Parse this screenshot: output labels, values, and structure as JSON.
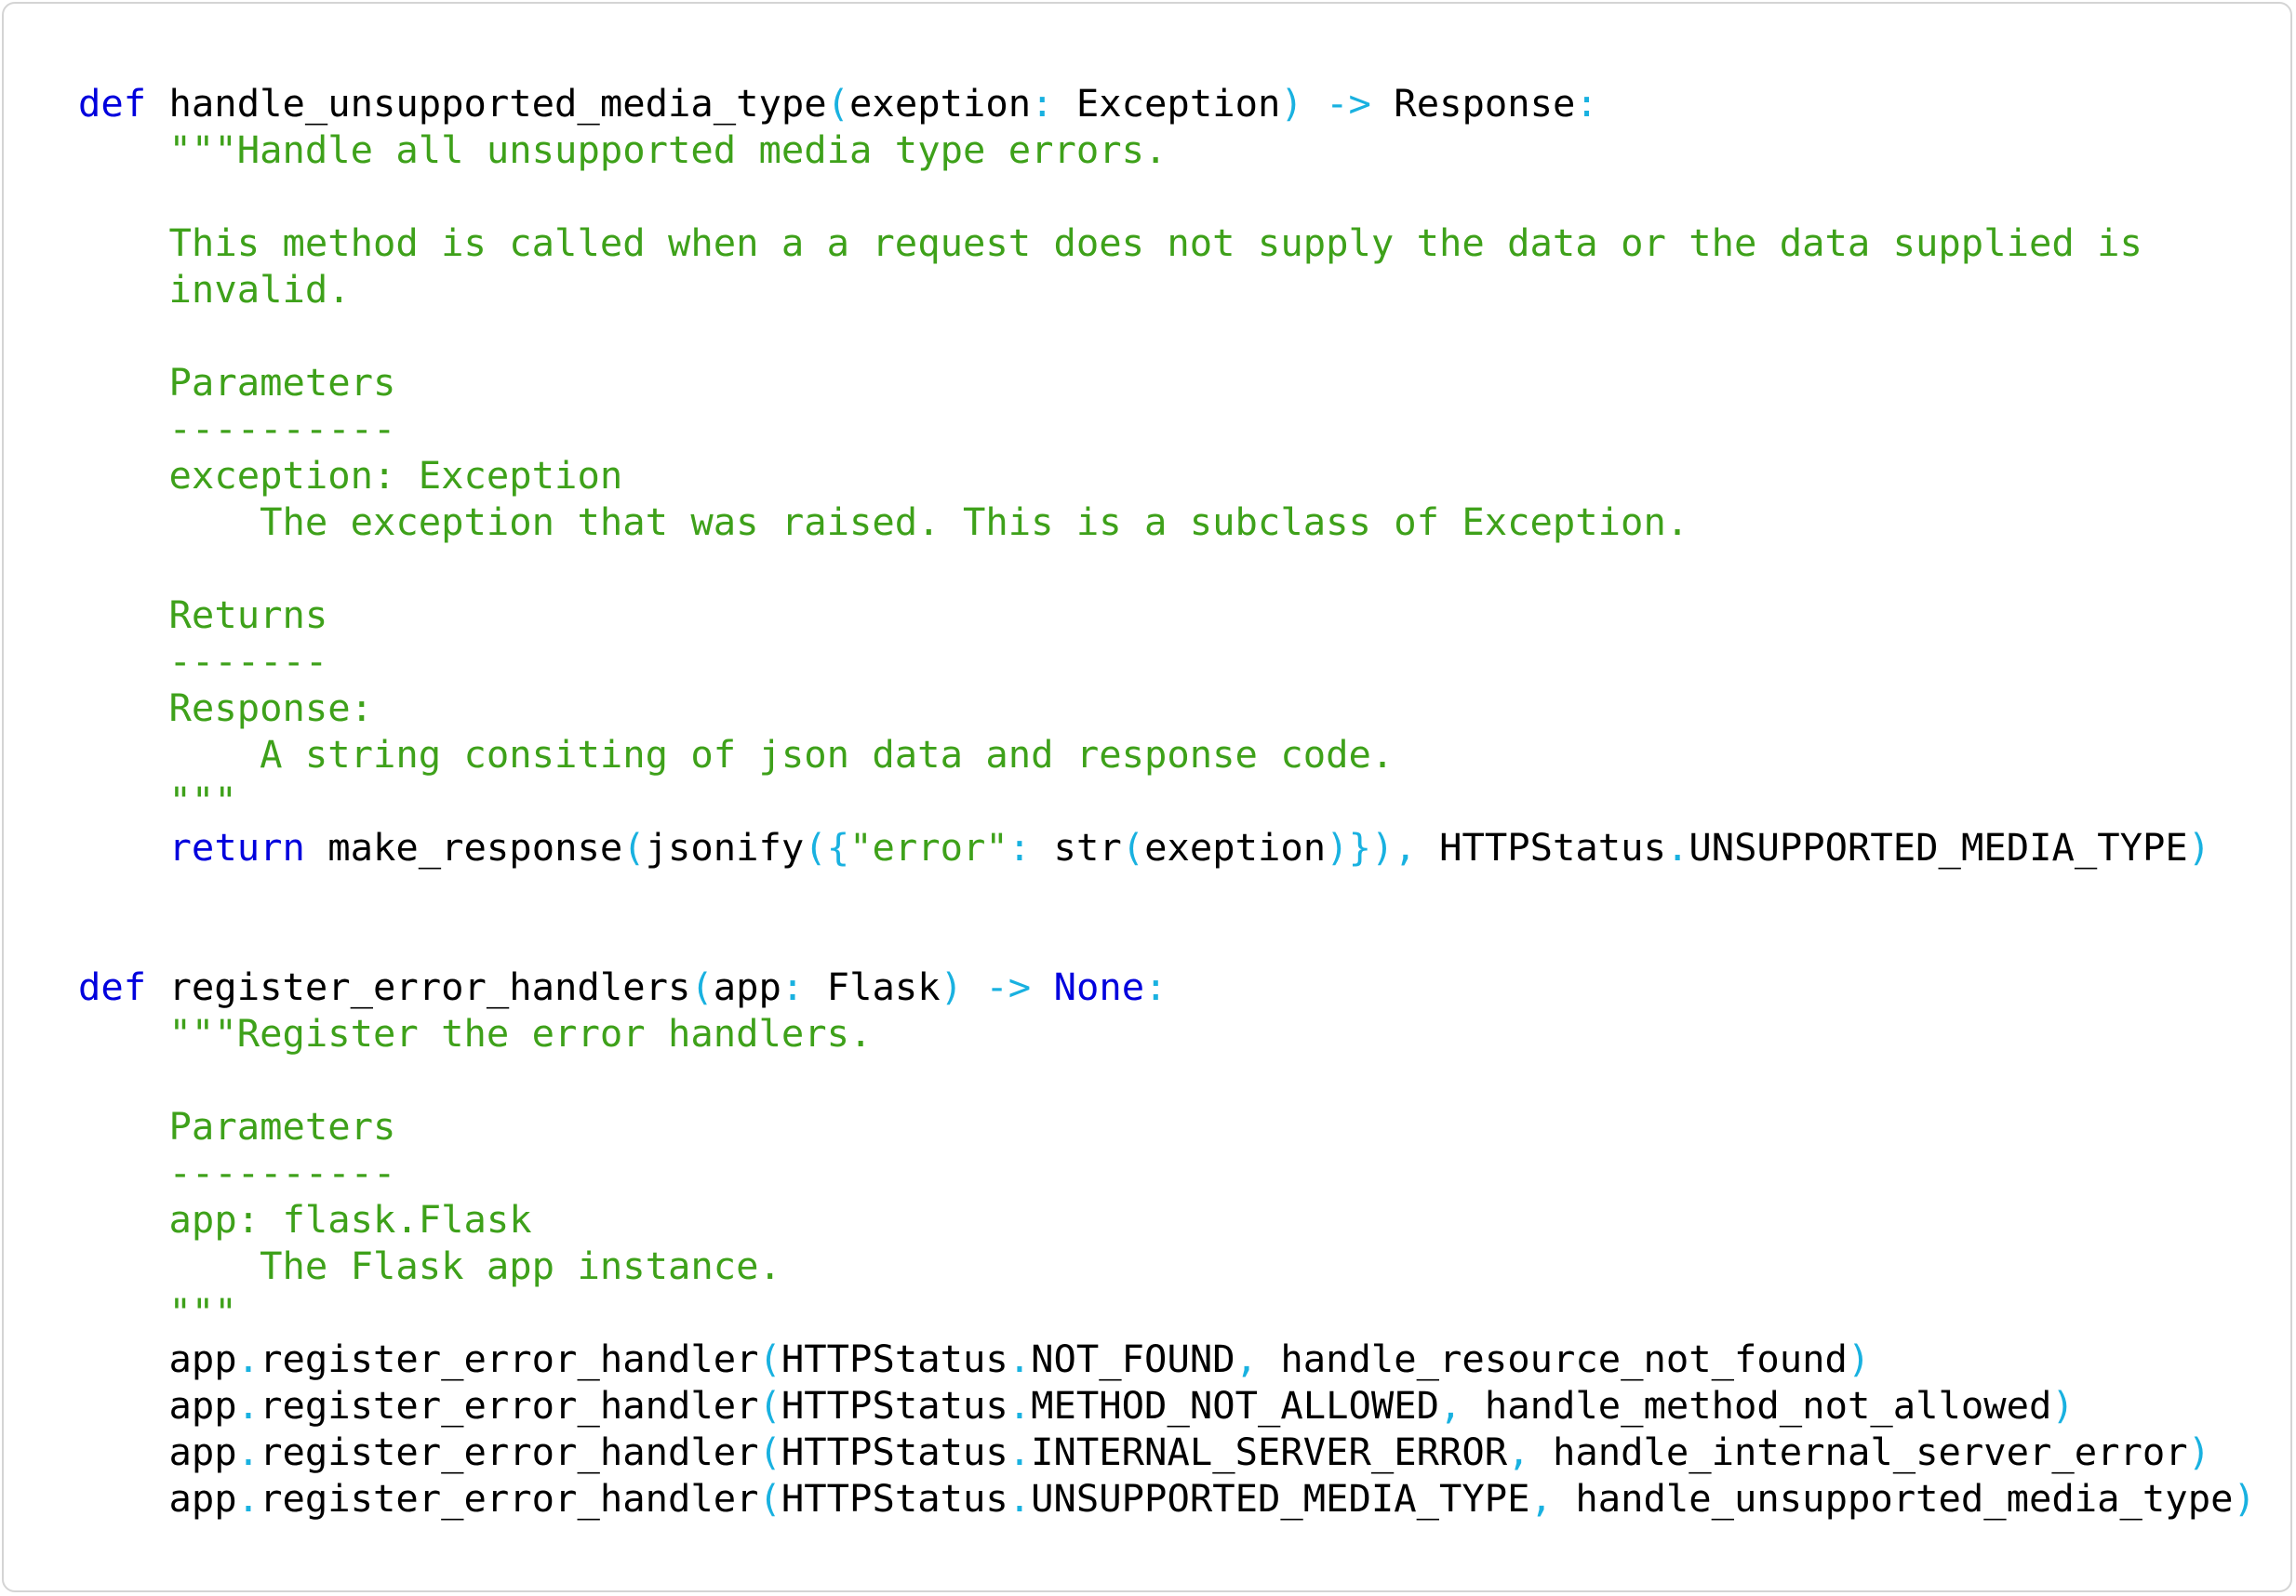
{
  "colors": {
    "keyword": "#0000dd",
    "operator": "#19b1e0",
    "string": "#3ea11a",
    "text": "#000000",
    "border": "#d4d4d4"
  },
  "lines": [
    [
      [
        "kw",
        "def"
      ],
      [
        "id",
        " handle_unsupported_media_type"
      ],
      [
        "op",
        "("
      ],
      [
        "id",
        "exeption"
      ],
      [
        "op",
        ":"
      ],
      [
        "id",
        " Exception"
      ],
      [
        "op",
        ")"
      ],
      [
        "id",
        " "
      ],
      [
        "op",
        "->"
      ],
      [
        "id",
        " Response"
      ],
      [
        "op",
        ":"
      ]
    ],
    [
      [
        "id",
        "    "
      ],
      [
        "str",
        "\"\"\"Handle all unsupported media type errors."
      ]
    ],
    [],
    [
      [
        "id",
        "    "
      ],
      [
        "str",
        "This method is called when a a request does not supply the data or the data supplied is"
      ]
    ],
    [
      [
        "id",
        "    "
      ],
      [
        "str",
        "invalid."
      ]
    ],
    [],
    [
      [
        "id",
        "    "
      ],
      [
        "str",
        "Parameters"
      ]
    ],
    [
      [
        "id",
        "    "
      ],
      [
        "str",
        "----------"
      ]
    ],
    [
      [
        "id",
        "    "
      ],
      [
        "str",
        "exception: Exception"
      ]
    ],
    [
      [
        "id",
        "        "
      ],
      [
        "str",
        "The exception that was raised. This is a subclass of Exception."
      ]
    ],
    [],
    [
      [
        "id",
        "    "
      ],
      [
        "str",
        "Returns"
      ]
    ],
    [
      [
        "id",
        "    "
      ],
      [
        "str",
        "-------"
      ]
    ],
    [
      [
        "id",
        "    "
      ],
      [
        "str",
        "Response:"
      ]
    ],
    [
      [
        "id",
        "        "
      ],
      [
        "str",
        "A string consiting of json data and response code."
      ]
    ],
    [
      [
        "id",
        "    "
      ],
      [
        "str",
        "\"\"\""
      ]
    ],
    [
      [
        "id",
        "    "
      ],
      [
        "kw",
        "return"
      ],
      [
        "id",
        " make_response"
      ],
      [
        "op",
        "("
      ],
      [
        "id",
        "jsonify"
      ],
      [
        "op",
        "({"
      ],
      [
        "str",
        "\"error\""
      ],
      [
        "op",
        ":"
      ],
      [
        "id",
        " str"
      ],
      [
        "op",
        "("
      ],
      [
        "id",
        "exeption"
      ],
      [
        "op",
        ")}),"
      ],
      [
        "id",
        " HTTPStatus"
      ],
      [
        "op",
        "."
      ],
      [
        "id",
        "UNSUPPORTED_MEDIA_TYPE"
      ],
      [
        "op",
        ")"
      ]
    ],
    [],
    [],
    [
      [
        "kw",
        "def"
      ],
      [
        "id",
        " register_error_handlers"
      ],
      [
        "op",
        "("
      ],
      [
        "id",
        "app"
      ],
      [
        "op",
        ":"
      ],
      [
        "id",
        " Flask"
      ],
      [
        "op",
        ")"
      ],
      [
        "id",
        " "
      ],
      [
        "op",
        "->"
      ],
      [
        "id",
        " "
      ],
      [
        "kw",
        "None"
      ],
      [
        "op",
        ":"
      ]
    ],
    [
      [
        "id",
        "    "
      ],
      [
        "str",
        "\"\"\"Register the error handlers."
      ]
    ],
    [],
    [
      [
        "id",
        "    "
      ],
      [
        "str",
        "Parameters"
      ]
    ],
    [
      [
        "id",
        "    "
      ],
      [
        "str",
        "----------"
      ]
    ],
    [
      [
        "id",
        "    "
      ],
      [
        "str",
        "app: flask.Flask"
      ]
    ],
    [
      [
        "id",
        "        "
      ],
      [
        "str",
        "The Flask app instance."
      ]
    ],
    [
      [
        "id",
        "    "
      ],
      [
        "str",
        "\"\"\""
      ]
    ],
    [
      [
        "id",
        "    app"
      ],
      [
        "op",
        "."
      ],
      [
        "id",
        "register_error_handler"
      ],
      [
        "op",
        "("
      ],
      [
        "id",
        "HTTPStatus"
      ],
      [
        "op",
        "."
      ],
      [
        "id",
        "NOT_FOUND"
      ],
      [
        "op",
        ","
      ],
      [
        "id",
        " handle_resource_not_found"
      ],
      [
        "op",
        ")"
      ]
    ],
    [
      [
        "id",
        "    app"
      ],
      [
        "op",
        "."
      ],
      [
        "id",
        "register_error_handler"
      ],
      [
        "op",
        "("
      ],
      [
        "id",
        "HTTPStatus"
      ],
      [
        "op",
        "."
      ],
      [
        "id",
        "METHOD_NOT_ALLOWED"
      ],
      [
        "op",
        ","
      ],
      [
        "id",
        " handle_method_not_allowed"
      ],
      [
        "op",
        ")"
      ]
    ],
    [
      [
        "id",
        "    app"
      ],
      [
        "op",
        "."
      ],
      [
        "id",
        "register_error_handler"
      ],
      [
        "op",
        "("
      ],
      [
        "id",
        "HTTPStatus"
      ],
      [
        "op",
        "."
      ],
      [
        "id",
        "INTERNAL_SERVER_ERROR"
      ],
      [
        "op",
        ","
      ],
      [
        "id",
        " handle_internal_server_error"
      ],
      [
        "op",
        ")"
      ]
    ],
    [
      [
        "id",
        "    app"
      ],
      [
        "op",
        "."
      ],
      [
        "id",
        "register_error_handler"
      ],
      [
        "op",
        "("
      ],
      [
        "id",
        "HTTPStatus"
      ],
      [
        "op",
        "."
      ],
      [
        "id",
        "UNSUPPORTED_MEDIA_TYPE"
      ],
      [
        "op",
        ","
      ],
      [
        "id",
        " handle_unsupported_media_type"
      ],
      [
        "op",
        ")"
      ]
    ]
  ]
}
